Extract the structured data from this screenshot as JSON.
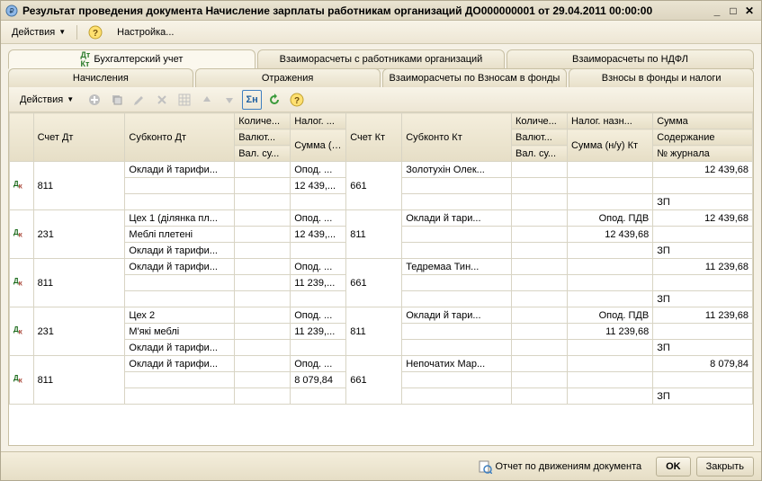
{
  "window": {
    "title": "Результат проведения документа Начисление зарплаты работникам организаций ДО000000001 от 29.04.2011 00:00:00"
  },
  "menubar": {
    "actions": "Действия",
    "settings": "Настройка..."
  },
  "tabs_row1": [
    {
      "label": "Бухгалтерский учет",
      "active": true,
      "has_dk": true
    },
    {
      "label": "Взаиморасчеты с работниками организаций",
      "active": false
    },
    {
      "label": "Взаиморасчеты по НДФЛ",
      "active": false
    }
  ],
  "tabs_row2": [
    {
      "label": "Начисления",
      "active": false
    },
    {
      "label": "Отражения",
      "active": false
    },
    {
      "label": "Взаиморасчеты по Взносам в фонды",
      "active": false
    },
    {
      "label": "Взносы в фонды и налоги",
      "active": false
    }
  ],
  "toolbar": {
    "actions": "Действия"
  },
  "grid": {
    "headers": {
      "r1": [
        "",
        "Счет Дт",
        "Субконто Дт",
        "Количе...",
        "Налог. ...",
        "Счет Кт",
        "Субконто Кт",
        "Количе...",
        "Налог. назн...",
        "Сумма"
      ],
      "r2": [
        "",
        "",
        "",
        "Валют...",
        "Сумма (н/у) Дт",
        "",
        "",
        "Валют...",
        "Сумма (н/у) Кт",
        "Содержание"
      ],
      "r3": [
        "",
        "",
        "",
        "Вал. су...",
        "",
        "",
        "",
        "Вал. су...",
        "",
        "№ журнала"
      ]
    },
    "rows": [
      {
        "acct_dt": "811",
        "sub_dt": [
          "Оклади й тарифи...",
          "",
          ""
        ],
        "qty_dt": [
          "",
          "",
          ""
        ],
        "tax_dt": [
          "Опод. ...",
          "12 439,...",
          ""
        ],
        "acct_kt": "661",
        "sub_kt": [
          "Золотухін Олек...",
          "",
          ""
        ],
        "qty_kt": [
          "",
          "",
          ""
        ],
        "tax_kt": [
          "",
          "",
          ""
        ],
        "sum": [
          "12 439,68",
          "",
          "ЗП"
        ]
      },
      {
        "acct_dt": "231",
        "sub_dt": [
          "Цех 1 (ділянка пл...",
          "Меблі плетені",
          "Оклади й тарифи..."
        ],
        "qty_dt": [
          "",
          "",
          ""
        ],
        "tax_dt": [
          "Опод. ...",
          "12 439,...",
          ""
        ],
        "acct_kt": "811",
        "sub_kt": [
          "Оклади й тари...",
          "",
          ""
        ],
        "qty_kt": [
          "",
          "",
          ""
        ],
        "tax_kt": [
          "Опод. ПДВ",
          "12 439,68",
          ""
        ],
        "sum": [
          "12 439,68",
          "",
          "ЗП"
        ]
      },
      {
        "acct_dt": "811",
        "sub_dt": [
          "Оклади й тарифи...",
          "",
          ""
        ],
        "qty_dt": [
          "",
          "",
          ""
        ],
        "tax_dt": [
          "Опод. ...",
          "11 239,...",
          ""
        ],
        "acct_kt": "661",
        "sub_kt": [
          "Тедремаа Тин...",
          "",
          ""
        ],
        "qty_kt": [
          "",
          "",
          ""
        ],
        "tax_kt": [
          "",
          "",
          ""
        ],
        "sum": [
          "11 239,68",
          "",
          "ЗП"
        ]
      },
      {
        "acct_dt": "231",
        "sub_dt": [
          "Цех 2",
          "М'які меблі",
          "Оклади й тарифи..."
        ],
        "qty_dt": [
          "",
          "",
          ""
        ],
        "tax_dt": [
          "Опод. ...",
          "11 239,...",
          ""
        ],
        "acct_kt": "811",
        "sub_kt": [
          "Оклади й тари...",
          "",
          ""
        ],
        "qty_kt": [
          "",
          "",
          ""
        ],
        "tax_kt": [
          "Опод. ПДВ",
          "11 239,68",
          ""
        ],
        "sum": [
          "11 239,68",
          "",
          "ЗП"
        ]
      },
      {
        "acct_dt": "811",
        "sub_dt": [
          "Оклади й тарифи...",
          "",
          ""
        ],
        "qty_dt": [
          "",
          "",
          ""
        ],
        "tax_dt": [
          "Опод. ...",
          "8 079,84",
          ""
        ],
        "acct_kt": "661",
        "sub_kt": [
          "Непочатих Мар...",
          "",
          ""
        ],
        "qty_kt": [
          "",
          "",
          ""
        ],
        "tax_kt": [
          "",
          "",
          ""
        ],
        "sum": [
          "8 079,84",
          "",
          "ЗП"
        ]
      }
    ]
  },
  "footer": {
    "report_link": "Отчет по движениям документа",
    "ok": "OK",
    "close": "Закрыть"
  }
}
